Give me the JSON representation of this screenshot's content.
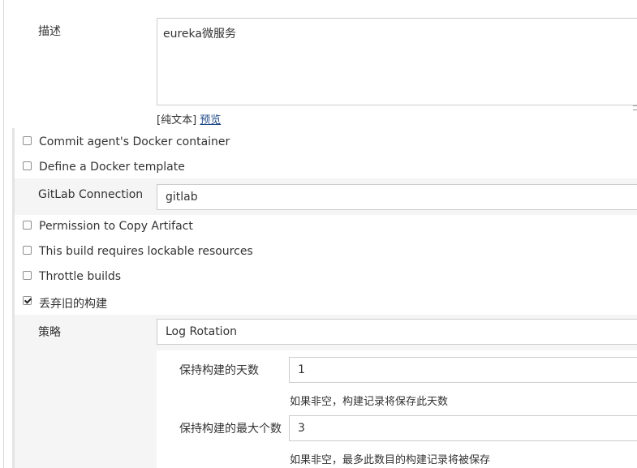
{
  "description": {
    "label": "描述",
    "value": "eureka微服务",
    "text_mode": "[纯文本]",
    "preview_link": "预览"
  },
  "options": {
    "commit_docker": "Commit agent's Docker container",
    "define_docker": "Define a Docker template",
    "gitlab_label": "GitLab Connection",
    "gitlab_value": "gitlab",
    "permission_copy": "Permission to Copy Artifact",
    "lockable": "This build requires lockable resources",
    "throttle": "Throttle builds",
    "discard_old": "丢弃旧的构建"
  },
  "strategy": {
    "label": "策略",
    "value": "Log Rotation",
    "days_label": "保持构建的天数",
    "days_value": "1",
    "days_help": "如果非空，构建记录将保存此天数",
    "max_label": "保持构建的最大个数",
    "max_value": "3",
    "max_help": "如果非空，最多此数目的构建记录将被保存"
  }
}
